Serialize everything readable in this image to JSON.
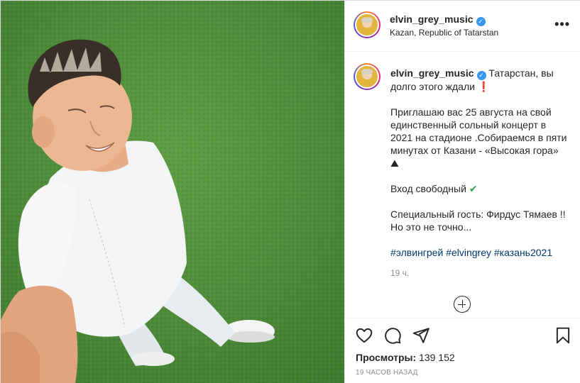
{
  "post": {
    "username": "elvin_grey_music",
    "location": "Kazan, Republic of Tatarstan",
    "more_icon": "more-horizontal-icon"
  },
  "caption": {
    "username": "elvin_grey_music",
    "line1": "Татарстан, вы долго этого ждали",
    "line1_emoji": "❗",
    "paragraph2": "Приглашаю вас 25 августа на свой единственный сольный концерт в 2021 на стадионе .Собираемся в пяти минутах от Казани - «Высокая гора»",
    "paragraph2_emoji": "⛰",
    "paragraph3": "Вход свободный",
    "paragraph3_emoji": "✔",
    "paragraph4": "Специальный гость: Фирдус Тямаев !!Но это не точно...",
    "hashtags": [
      "#элвингрей",
      "#elvingrey",
      "#казань2021"
    ],
    "time": "19 ч."
  },
  "actions": {
    "views_label": "Просмотры:",
    "views_count": "139 152",
    "posted_ago": "19 ЧАСОВ НАЗАД"
  },
  "colors": {
    "verified": "#3897f0",
    "hashtag": "#00376b",
    "muted": "#8e8e8e",
    "emoji_check": "#2e9e3f",
    "emoji_exclaim": "#c62828"
  }
}
